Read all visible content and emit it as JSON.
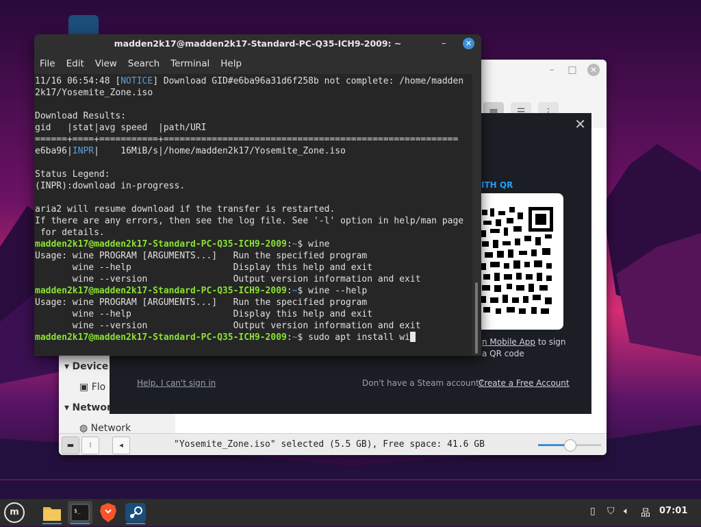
{
  "terminal": {
    "title": "madden2k17@madden2k17-Standard-PC-Q35-ICH9-2009: ~",
    "menu": [
      "File",
      "Edit",
      "View",
      "Search",
      "Terminal",
      "Help"
    ],
    "lines": {
      "l1a": "11/16 06:54:48 [",
      "l1notice": "NOTICE",
      "l1b": "] Download GID#e6ba96a31d6f258b not complete: /home/madden",
      "l2": "2k17/Yosemite_Zone.iso",
      "l4": "Download Results:",
      "l5": "gid   |stat|avg speed  |path/URI",
      "l6": "======+====+===========+=======================================================",
      "l7a": "e6ba96|",
      "l7inpr": "INPR",
      "l7b": "|    16MiB/s|/home/madden2k17/Yosemite_Zone.iso",
      "l9": "Status Legend:",
      "l10": "(INPR):download in-progress.",
      "l12": "aria2 will resume download if the transfer is restarted.",
      "l13": "If there are any errors, then see the log file. See '-l' option in help/man page",
      "l14": " for details.",
      "prompt_user": "madden2k17@madden2k17-Standard-PC-Q35-ICH9-2009",
      "prompt_sep": ":",
      "prompt_path": "~",
      "prompt_end": "$ ",
      "cmd1": "wine",
      "usage1": "Usage: wine PROGRAM [ARGUMENTS...]   Run the specified program",
      "usage2": "       wine --help                   Display this help and exit",
      "usage3": "       wine --version                Output version information and exit",
      "cmd2": "wine --help",
      "cmd3": "sudo apt install wi"
    }
  },
  "file_manager": {
    "sidebar": {
      "devices": "Device",
      "floppy": "Flo",
      "network_header": "Networ",
      "network": "Network"
    },
    "status_text": "\"Yosemite_Zone.iso\" selected (5.5 GB), Free space: 41.6 GB",
    "zoom_level": 0.5
  },
  "steam": {
    "qr_label": "ITH QR",
    "mobile_app": "n Mobile App",
    "mobile_to_sign": " to sign",
    "qr_code": "a QR code",
    "help": "Help, I can't sign in",
    "no_account": "Don't have a Steam account?",
    "create": "Create a Free Account"
  },
  "taskbar": {
    "apps": [
      "files-icon",
      "terminal-icon",
      "brave-icon",
      "steam-icon"
    ],
    "clock": "07:01",
    "menu_label": "m"
  }
}
